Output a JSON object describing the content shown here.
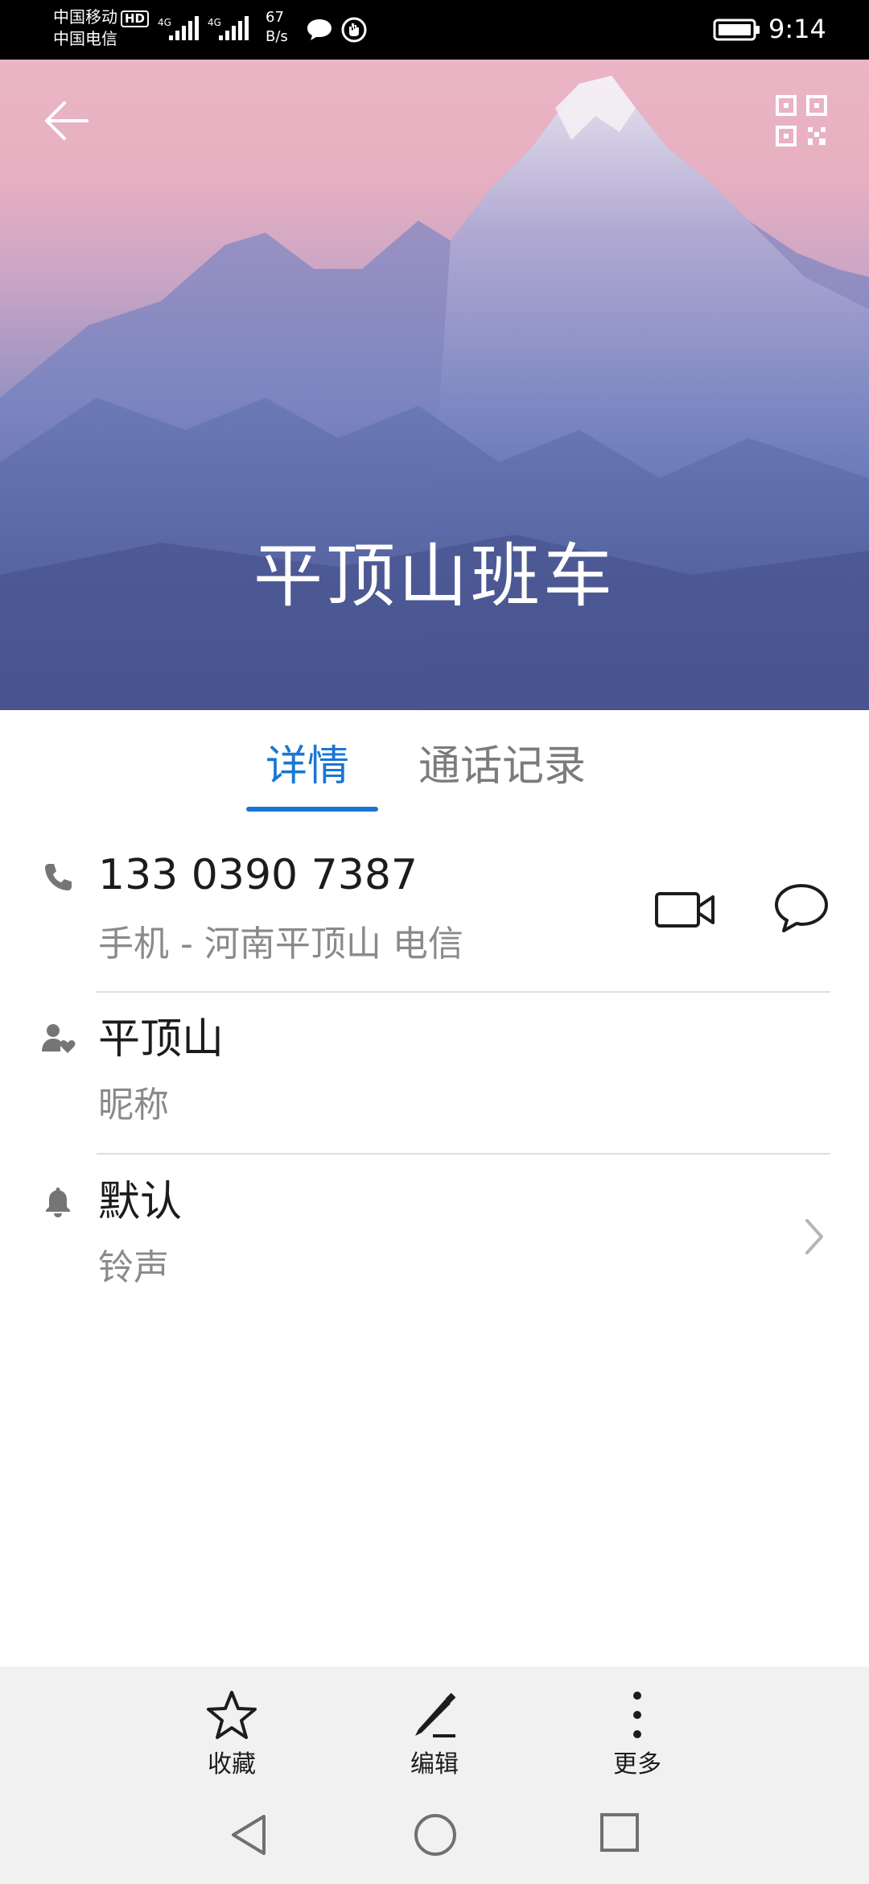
{
  "status_bar": {
    "carrier1": "中国移动",
    "carrier2": "中国电信",
    "hd_badge": "HD",
    "net1": "4G",
    "net2": "4G",
    "speed_value": "67",
    "speed_unit": "B/s",
    "time": "9:14",
    "icons": [
      "chat-bubble-icon",
      "app-notification-icon",
      "battery-icon"
    ]
  },
  "header": {
    "back_icon": "arrow-left-icon",
    "qr_icon": "qr-code-icon",
    "contact_name": "平顶山班车"
  },
  "tabs": [
    {
      "label": "详情",
      "active": true
    },
    {
      "label": "通话记录",
      "active": false
    }
  ],
  "details": {
    "phone": {
      "number": "133 0390 7387",
      "subtitle": "手机 - 河南平顶山 电信",
      "icon": "phone-icon"
    },
    "nickname": {
      "value": "平顶山",
      "label": "昵称",
      "icon": "contact-heart-icon"
    },
    "ringtone": {
      "value": "默认",
      "label": "铃声",
      "icon": "bell-icon"
    }
  },
  "actions": [
    {
      "label": "收藏",
      "icon": "star-icon"
    },
    {
      "label": "编辑",
      "icon": "pen-icon"
    },
    {
      "label": "更多",
      "icon": "more-vertical-icon"
    }
  ],
  "colors": {
    "accent": "#1a76d2",
    "text_primary": "#1c1c1c",
    "text_secondary": "#8a8a8a",
    "action_bar_bg": "#f1f1f1"
  }
}
